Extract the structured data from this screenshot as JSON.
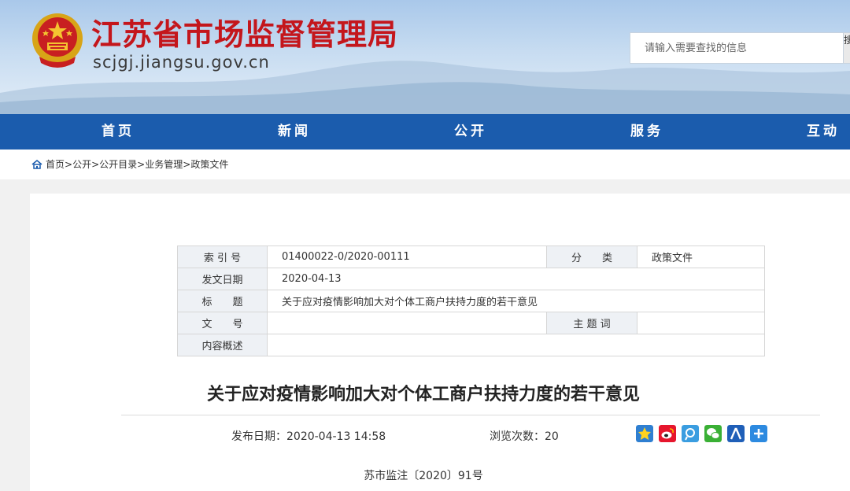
{
  "header": {
    "title": "江苏省市场监督管理局",
    "domain": "scjgj.jiangsu.gov.cn",
    "search_placeholder": "请输入需要查找的信息",
    "search_button": "搜"
  },
  "nav": {
    "items": [
      "首页",
      "新闻",
      "公开",
      "服务",
      "互动"
    ]
  },
  "breadcrumb": {
    "items": [
      "首页",
      "公开",
      "公开目录",
      "业务管理",
      "政策文件"
    ],
    "separator": ">"
  },
  "meta_table": {
    "index_label": "索 引 号",
    "index_value": "01400022-0/2020-00111",
    "category_label": "分　　类",
    "category_value": "政策文件",
    "date_label": "发文日期",
    "date_value": "2020-04-13",
    "title_label": "标　　题",
    "title_value": "关于应对疫情影响加大对个体工商户扶持力度的若干意见",
    "docnum_label": "文　　号",
    "docnum_value": "",
    "subject_label": "主 题 词",
    "subject_value": "",
    "summary_label": "内容概述",
    "summary_value": ""
  },
  "article": {
    "title": "关于应对疫情影响加大对个体工商户扶持力度的若干意见",
    "publish_label": "发布日期：",
    "publish_value": "2020-04-13 14:58",
    "views_label": "浏览次数：",
    "views_value": "20",
    "doc_number": "苏市监注〔2020〕91号"
  },
  "share_icons": [
    "qzone-icon",
    "weibo-icon",
    "tencent-weibo-icon",
    "wechat-icon",
    "renren-icon",
    "more-share-icon"
  ],
  "colors": {
    "nav_bg": "#1b5cad",
    "title_red": "#c4161c",
    "header_sky": "#bcd4ee"
  }
}
